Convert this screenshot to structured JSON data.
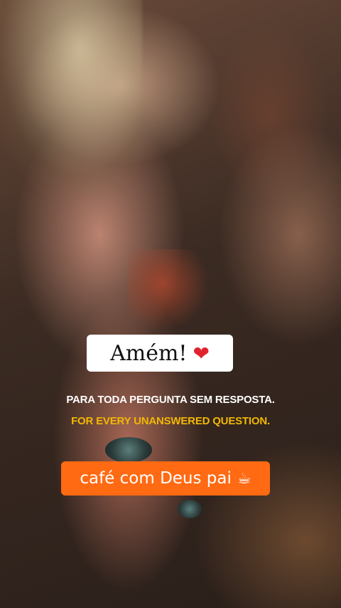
{
  "overlay": {
    "caption": "Amém!",
    "caption_icon": "heart-icon",
    "heart_glyph": "❤",
    "line_pt": "PARA TODA PERGUNTA SEM RESPOSTA.",
    "line_en": "FOR EVERY UNANSWERED QUESTION.",
    "channel": "café com Deus pai",
    "channel_icon": "coffee-cup-icon",
    "cup_glyph": "☕"
  },
  "colors": {
    "caption_bg": "#ffffff",
    "line_pt": "#ffffff",
    "line_en": "#f2b705",
    "pill_bg": "#ff6a13",
    "heart": "#e0222c"
  }
}
